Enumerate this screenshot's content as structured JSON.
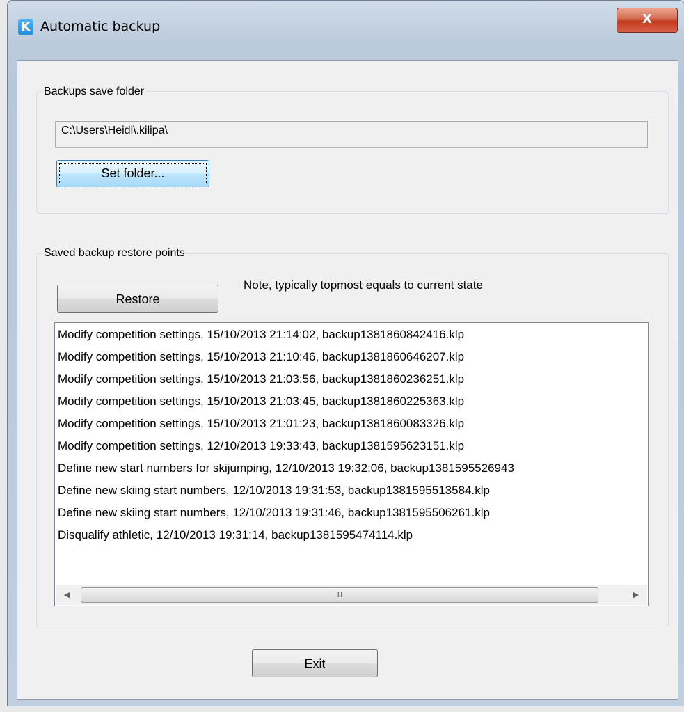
{
  "window": {
    "title": "Automatic backup",
    "icon_letter": "K",
    "close_glyph": "X"
  },
  "folder_group": {
    "label": "Backups save folder",
    "path_value": "C:\\Users\\Heidi\\.kilipa\\",
    "set_folder_label": "Set folder..."
  },
  "restore_group": {
    "label": "Saved backup restore points",
    "restore_label": "Restore",
    "note": "Note, typically topmost equals to current state",
    "items": [
      "Modify competition settings, 15/10/2013 21:14:02, backup1381860842416.klp",
      "Modify competition settings, 15/10/2013 21:10:46, backup1381860646207.klp",
      "Modify competition settings, 15/10/2013 21:03:56, backup1381860236251.klp",
      "Modify competition settings, 15/10/2013 21:03:45, backup1381860225363.klp",
      "Modify competition settings, 15/10/2013 21:01:23, backup1381860083326.klp",
      "Modify competition settings, 12/10/2013 19:33:43, backup1381595623151.klp",
      "Define new start numbers for skijumping, 12/10/2013 19:32:06, backup1381595526943",
      "Define new skiing start numbers, 12/10/2013 19:31:53, backup1381595513584.klp",
      "Define new skiing start numbers, 12/10/2013 19:31:46, backup1381595506261.klp",
      "Disqualify athletic, 12/10/2013 19:31:14, backup1381595474114.klp"
    ],
    "scroll_left_glyph": "◀",
    "scroll_right_glyph": "▶",
    "scroll_thumb_grip": "III"
  },
  "exit_label": "Exit"
}
